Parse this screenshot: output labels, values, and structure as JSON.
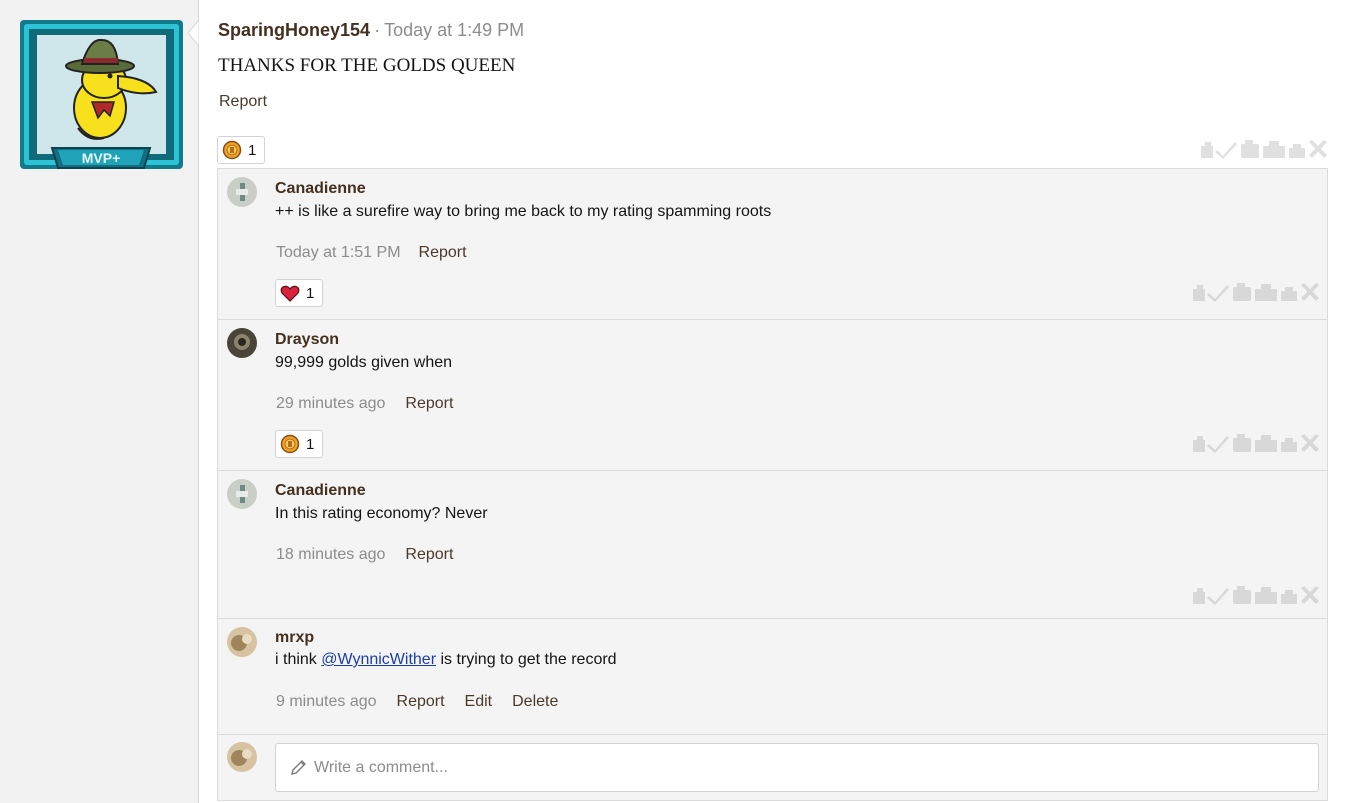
{
  "post": {
    "username": "SparingHoney154",
    "separator": "·",
    "timestamp": "Today at 1:49 PM",
    "body": "THANKS FOR THE GOLDS QUEEN",
    "report_label": "Report",
    "badge_text": "MVP+",
    "reaction": {
      "icon": "gold-ingot-icon",
      "count": "1"
    }
  },
  "comments": [
    {
      "name": "Canadienne",
      "text": "++ is like a surefire way to bring me back to my rating spamming roots",
      "time": "Today at 1:51 PM",
      "actions": [
        "Report"
      ],
      "reaction": {
        "icon": "heart-icon",
        "count": "1"
      }
    },
    {
      "name": "Drayson",
      "text": "99,999 golds given when",
      "time": "29 minutes ago",
      "actions": [
        "Report"
      ],
      "reaction": {
        "icon": "gold-ingot-icon",
        "count": "1"
      }
    },
    {
      "name": "Canadienne",
      "text": "In this rating economy? Never",
      "time": "18 minutes ago",
      "actions": [
        "Report"
      ]
    },
    {
      "name": "mrxp",
      "text_before": "i think ",
      "mention": "@WynnicWither",
      "text_after": " is trying to get the record",
      "time": "9 minutes ago",
      "actions": [
        "Report",
        "Edit",
        "Delete"
      ]
    }
  ],
  "write_comment": {
    "placeholder": "Write a comment..."
  },
  "colors": {
    "username": "#45301f",
    "muted": "#8c8c8c",
    "mention": "#1d3ea8",
    "panel": "#f4f4f4",
    "frame_teal": "#1fa3b8"
  },
  "icons": [
    "pencil-icon",
    "rate-icons"
  ]
}
